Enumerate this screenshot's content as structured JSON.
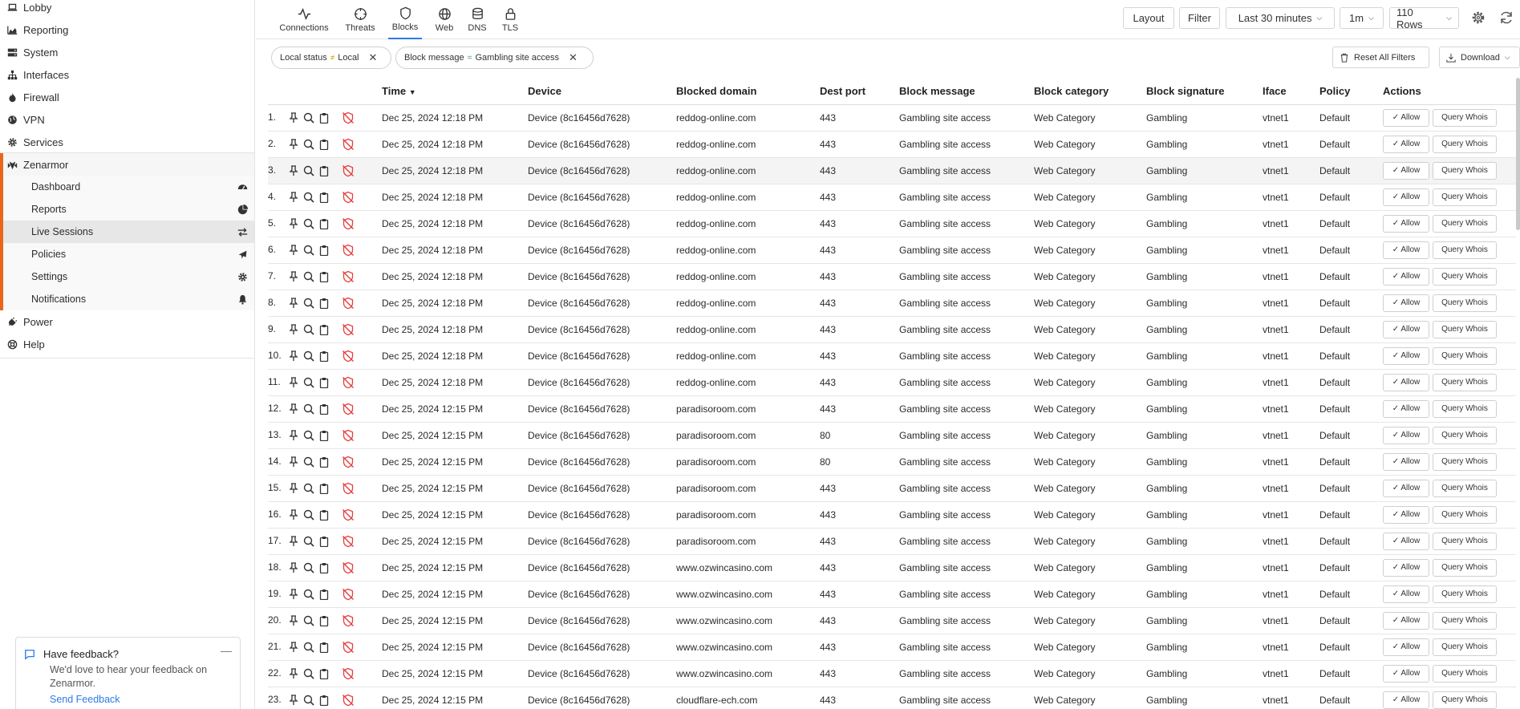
{
  "sidebar": {
    "items": [
      {
        "label": "Lobby",
        "icon": "laptop-icon"
      },
      {
        "label": "Reporting",
        "icon": "area-chart-icon"
      },
      {
        "label": "System",
        "icon": "server-icon"
      },
      {
        "label": "Interfaces",
        "icon": "sitemap-icon"
      },
      {
        "label": "Firewall",
        "icon": "fire-icon"
      },
      {
        "label": "VPN",
        "icon": "globe-icon"
      },
      {
        "label": "Services",
        "icon": "cog-icon"
      }
    ],
    "zenarmor": {
      "label": "Zenarmor",
      "accent": "#e9671a",
      "children": [
        {
          "label": "Dashboard",
          "icon": "dashboard-icon"
        },
        {
          "label": "Reports",
          "icon": "pie-chart-icon"
        },
        {
          "label": "Live Sessions",
          "icon": "exchange-icon"
        },
        {
          "label": "Policies",
          "icon": "plane-icon"
        },
        {
          "label": "Settings",
          "icon": "cog-icon"
        },
        {
          "label": "Notifications",
          "icon": "bell-icon"
        }
      ]
    },
    "bottom": [
      {
        "label": "Power",
        "icon": "plug-icon"
      },
      {
        "label": "Help",
        "icon": "life-ring-icon"
      }
    ]
  },
  "feedback": {
    "title": "Have feedback?",
    "text": "We'd love to hear your feedback on Zenarmor.",
    "link": "Send Feedback",
    "minimize": "—"
  },
  "tabs": [
    {
      "label": "Connections",
      "icon": "activity-icon"
    },
    {
      "label": "Threats",
      "icon": "crosshair-icon"
    },
    {
      "label": "Blocks",
      "icon": "shield-icon"
    },
    {
      "label": "Web",
      "icon": "globe-icon"
    },
    {
      "label": "DNS",
      "icon": "database-icon"
    },
    {
      "label": "TLS",
      "icon": "lock-icon"
    }
  ],
  "toolbar": {
    "layout": "Layout",
    "filter": "Filter",
    "range": "Last 30 minutes",
    "interval": "1m",
    "rows": "110 Rows"
  },
  "filters": [
    {
      "field": "Local status",
      "op": "≠",
      "value": "Local"
    },
    {
      "field": "Block message",
      "op": "=",
      "value": "Gambling site access"
    }
  ],
  "actions": {
    "reset": "Reset All Filters",
    "download": "Download"
  },
  "table": {
    "sort_arrow": "▼",
    "columns": [
      "Time",
      "Device",
      "Blocked domain",
      "Dest port",
      "Block message",
      "Block category",
      "Block signature",
      "Iface",
      "Policy",
      "Actions"
    ],
    "allow_label": "✓ Allow",
    "whois_label": "Query Whois",
    "rows": [
      {
        "n": "1.",
        "time": "Dec 25, 2024 12:18 PM",
        "device": "Device (8c16456d7628)",
        "domain": "reddog-online.com",
        "port": "443",
        "message": "Gambling site access",
        "category": "Web Category",
        "signature": "Gambling",
        "iface": "vtnet1",
        "policy": "Default"
      },
      {
        "n": "2.",
        "time": "Dec 25, 2024 12:18 PM",
        "device": "Device (8c16456d7628)",
        "domain": "reddog-online.com",
        "port": "443",
        "message": "Gambling site access",
        "category": "Web Category",
        "signature": "Gambling",
        "iface": "vtnet1",
        "policy": "Default"
      },
      {
        "n": "3.",
        "time": "Dec 25, 2024 12:18 PM",
        "device": "Device (8c16456d7628)",
        "domain": "reddog-online.com",
        "port": "443",
        "message": "Gambling site access",
        "category": "Web Category",
        "signature": "Gambling",
        "iface": "vtnet1",
        "policy": "Default"
      },
      {
        "n": "4.",
        "time": "Dec 25, 2024 12:18 PM",
        "device": "Device (8c16456d7628)",
        "domain": "reddog-online.com",
        "port": "443",
        "message": "Gambling site access",
        "category": "Web Category",
        "signature": "Gambling",
        "iface": "vtnet1",
        "policy": "Default"
      },
      {
        "n": "5.",
        "time": "Dec 25, 2024 12:18 PM",
        "device": "Device (8c16456d7628)",
        "domain": "reddog-online.com",
        "port": "443",
        "message": "Gambling site access",
        "category": "Web Category",
        "signature": "Gambling",
        "iface": "vtnet1",
        "policy": "Default"
      },
      {
        "n": "6.",
        "time": "Dec 25, 2024 12:18 PM",
        "device": "Device (8c16456d7628)",
        "domain": "reddog-online.com",
        "port": "443",
        "message": "Gambling site access",
        "category": "Web Category",
        "signature": "Gambling",
        "iface": "vtnet1",
        "policy": "Default"
      },
      {
        "n": "7.",
        "time": "Dec 25, 2024 12:18 PM",
        "device": "Device (8c16456d7628)",
        "domain": "reddog-online.com",
        "port": "443",
        "message": "Gambling site access",
        "category": "Web Category",
        "signature": "Gambling",
        "iface": "vtnet1",
        "policy": "Default"
      },
      {
        "n": "8.",
        "time": "Dec 25, 2024 12:18 PM",
        "device": "Device (8c16456d7628)",
        "domain": "reddog-online.com",
        "port": "443",
        "message": "Gambling site access",
        "category": "Web Category",
        "signature": "Gambling",
        "iface": "vtnet1",
        "policy": "Default"
      },
      {
        "n": "9.",
        "time": "Dec 25, 2024 12:18 PM",
        "device": "Device (8c16456d7628)",
        "domain": "reddog-online.com",
        "port": "443",
        "message": "Gambling site access",
        "category": "Web Category",
        "signature": "Gambling",
        "iface": "vtnet1",
        "policy": "Default"
      },
      {
        "n": "10.",
        "time": "Dec 25, 2024 12:18 PM",
        "device": "Device (8c16456d7628)",
        "domain": "reddog-online.com",
        "port": "443",
        "message": "Gambling site access",
        "category": "Web Category",
        "signature": "Gambling",
        "iface": "vtnet1",
        "policy": "Default"
      },
      {
        "n": "11.",
        "time": "Dec 25, 2024 12:18 PM",
        "device": "Device (8c16456d7628)",
        "domain": "reddog-online.com",
        "port": "443",
        "message": "Gambling site access",
        "category": "Web Category",
        "signature": "Gambling",
        "iface": "vtnet1",
        "policy": "Default"
      },
      {
        "n": "12.",
        "time": "Dec 25, 2024 12:15 PM",
        "device": "Device (8c16456d7628)",
        "domain": "paradisoroom.com",
        "port": "443",
        "message": "Gambling site access",
        "category": "Web Category",
        "signature": "Gambling",
        "iface": "vtnet1",
        "policy": "Default"
      },
      {
        "n": "13.",
        "time": "Dec 25, 2024 12:15 PM",
        "device": "Device (8c16456d7628)",
        "domain": "paradisoroom.com",
        "port": "80",
        "message": "Gambling site access",
        "category": "Web Category",
        "signature": "Gambling",
        "iface": "vtnet1",
        "policy": "Default"
      },
      {
        "n": "14.",
        "time": "Dec 25, 2024 12:15 PM",
        "device": "Device (8c16456d7628)",
        "domain": "paradisoroom.com",
        "port": "80",
        "message": "Gambling site access",
        "category": "Web Category",
        "signature": "Gambling",
        "iface": "vtnet1",
        "policy": "Default"
      },
      {
        "n": "15.",
        "time": "Dec 25, 2024 12:15 PM",
        "device": "Device (8c16456d7628)",
        "domain": "paradisoroom.com",
        "port": "443",
        "message": "Gambling site access",
        "category": "Web Category",
        "signature": "Gambling",
        "iface": "vtnet1",
        "policy": "Default"
      },
      {
        "n": "16.",
        "time": "Dec 25, 2024 12:15 PM",
        "device": "Device (8c16456d7628)",
        "domain": "paradisoroom.com",
        "port": "443",
        "message": "Gambling site access",
        "category": "Web Category",
        "signature": "Gambling",
        "iface": "vtnet1",
        "policy": "Default"
      },
      {
        "n": "17.",
        "time": "Dec 25, 2024 12:15 PM",
        "device": "Device (8c16456d7628)",
        "domain": "paradisoroom.com",
        "port": "443",
        "message": "Gambling site access",
        "category": "Web Category",
        "signature": "Gambling",
        "iface": "vtnet1",
        "policy": "Default"
      },
      {
        "n": "18.",
        "time": "Dec 25, 2024 12:15 PM",
        "device": "Device (8c16456d7628)",
        "domain": "www.ozwincasino.com",
        "port": "443",
        "message": "Gambling site access",
        "category": "Web Category",
        "signature": "Gambling",
        "iface": "vtnet1",
        "policy": "Default"
      },
      {
        "n": "19.",
        "time": "Dec 25, 2024 12:15 PM",
        "device": "Device (8c16456d7628)",
        "domain": "www.ozwincasino.com",
        "port": "443",
        "message": "Gambling site access",
        "category": "Web Category",
        "signature": "Gambling",
        "iface": "vtnet1",
        "policy": "Default"
      },
      {
        "n": "20.",
        "time": "Dec 25, 2024 12:15 PM",
        "device": "Device (8c16456d7628)",
        "domain": "www.ozwincasino.com",
        "port": "443",
        "message": "Gambling site access",
        "category": "Web Category",
        "signature": "Gambling",
        "iface": "vtnet1",
        "policy": "Default"
      },
      {
        "n": "21.",
        "time": "Dec 25, 2024 12:15 PM",
        "device": "Device (8c16456d7628)",
        "domain": "www.ozwincasino.com",
        "port": "443",
        "message": "Gambling site access",
        "category": "Web Category",
        "signature": "Gambling",
        "iface": "vtnet1",
        "policy": "Default"
      },
      {
        "n": "22.",
        "time": "Dec 25, 2024 12:15 PM",
        "device": "Device (8c16456d7628)",
        "domain": "www.ozwincasino.com",
        "port": "443",
        "message": "Gambling site access",
        "category": "Web Category",
        "signature": "Gambling",
        "iface": "vtnet1",
        "policy": "Default"
      },
      {
        "n": "23.",
        "time": "Dec 25, 2024 12:15 PM",
        "device": "Device (8c16456d7628)",
        "domain": "cloudflare-ech.com",
        "port": "443",
        "message": "Gambling site access",
        "category": "Web Category",
        "signature": "Gambling",
        "iface": "vtnet1",
        "policy": "Default"
      }
    ]
  },
  "colors": {
    "accent": "#e9671a",
    "active_tab": "#2c7be5",
    "block_icon": "#e53e3e",
    "link": "#2c7be5"
  }
}
